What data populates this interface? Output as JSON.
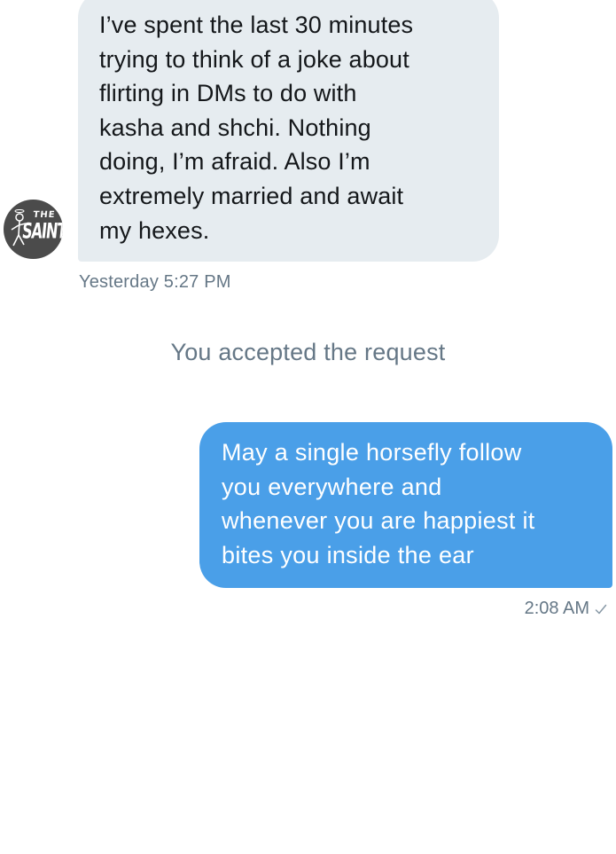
{
  "conversation": {
    "incoming": {
      "avatar_text": [
        "THE",
        "SAINT"
      ],
      "lines": [
        "I’ve spent the last 30 minutes",
        "trying to think of a joke about",
        "flirting in DMs to do with",
        "kasha and shchi. Nothing",
        "doing, I’m afraid. Also I’m",
        "extremely married and await",
        "my hexes."
      ],
      "timestamp": "Yesterday 5:27 PM"
    },
    "system_message": "You accepted the request",
    "outgoing": {
      "lines": [
        "May a single horsefly follow",
        "you everywhere and",
        "whenever you are happiest it",
        "bites you inside the ear"
      ],
      "timestamp": "2:08 AM",
      "status_icon": "check-icon"
    }
  },
  "colors": {
    "incoming_bubble": "#e6ecf0",
    "outgoing_bubble": "#4a9fe8",
    "meta_text": "#657786",
    "avatar_bg": "#4b4b4b"
  }
}
